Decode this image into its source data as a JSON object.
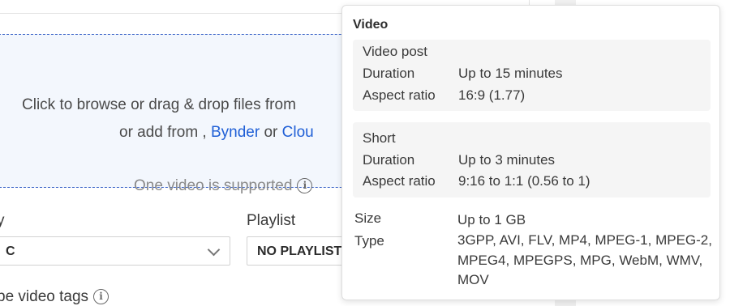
{
  "upload": {
    "line1": "Click to browse or drag & drop files from",
    "line2_prefix": "or add from , ",
    "bynder_link": "Bynder",
    "or_text": " or ",
    "cloud_link": "Clou",
    "hint": "One video is supported"
  },
  "fields": {
    "visibility_label": "y",
    "visibility_value": "C",
    "playlist_label": "Playlist",
    "playlist_value": "NO PLAYLIST",
    "tags_label": "pe video tags"
  },
  "tooltip": {
    "title": "Video",
    "video_post": {
      "title": "Video post",
      "duration_label": "Duration",
      "duration_value": "Up to 15 minutes",
      "aspect_label": "Aspect ratio",
      "aspect_value": "16:9 (1.77)"
    },
    "short": {
      "title": "Short",
      "duration_label": "Duration",
      "duration_value": "Up to 3 minutes",
      "aspect_label": "Aspect ratio",
      "aspect_value": "9:16 to 1:1 (0.56 to 1)"
    },
    "general": {
      "size_label": "Size",
      "size_value": "Up to 1 GB",
      "type_label": "Type",
      "type_value": "3GPP, AVI, FLV, MP4, MPEG-1, MPEG-2, MPEG4, MPEGPS, MPG, WebM, WMV, MOV"
    }
  },
  "colors": {
    "link": "#1f5fd6",
    "dropzone_bg": "#f3f7fd",
    "dropzone_border": "#3f67c9"
  },
  "icons": {
    "info": "info-circle-icon",
    "dropdown": "chevron-down-icon"
  }
}
